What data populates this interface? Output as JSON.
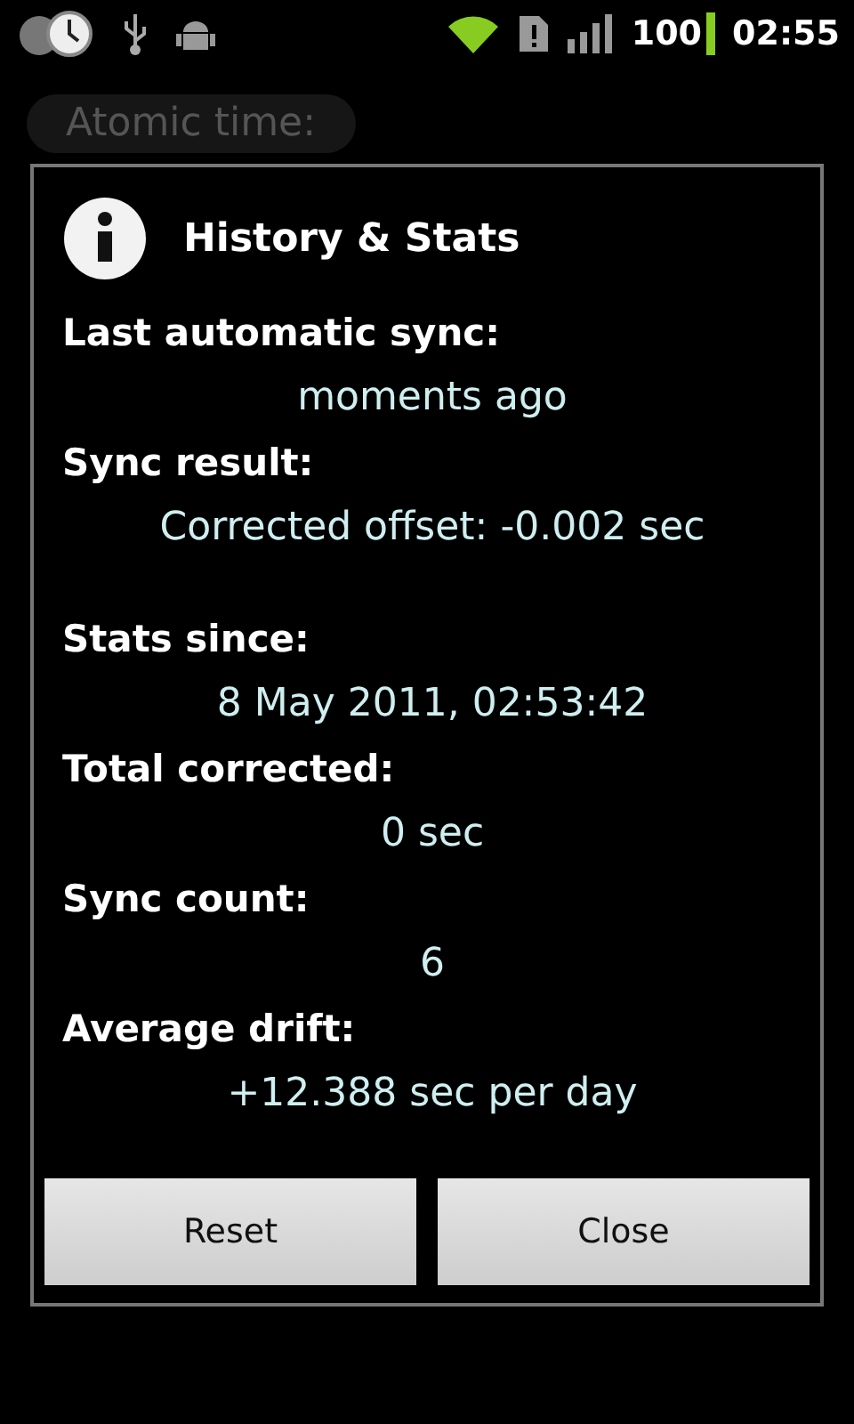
{
  "status_bar": {
    "battery": "100",
    "time": "02:55"
  },
  "background": {
    "label": "Atomic time:"
  },
  "dialog": {
    "title": "History & Stats",
    "groups": [
      [
        {
          "label": "Last automatic sync:",
          "value": "moments ago"
        },
        {
          "label": "Sync result:",
          "value": "Corrected offset: -0.002 sec"
        }
      ],
      [
        {
          "label": "Stats since:",
          "value": "8 May 2011, 02:53:42"
        },
        {
          "label": "Total corrected:",
          "value": "0 sec"
        },
        {
          "label": "Sync count:",
          "value": "6"
        },
        {
          "label": "Average drift:",
          "value": "+12.388 sec per day"
        }
      ]
    ],
    "buttons": [
      "Reset",
      "Close"
    ]
  }
}
